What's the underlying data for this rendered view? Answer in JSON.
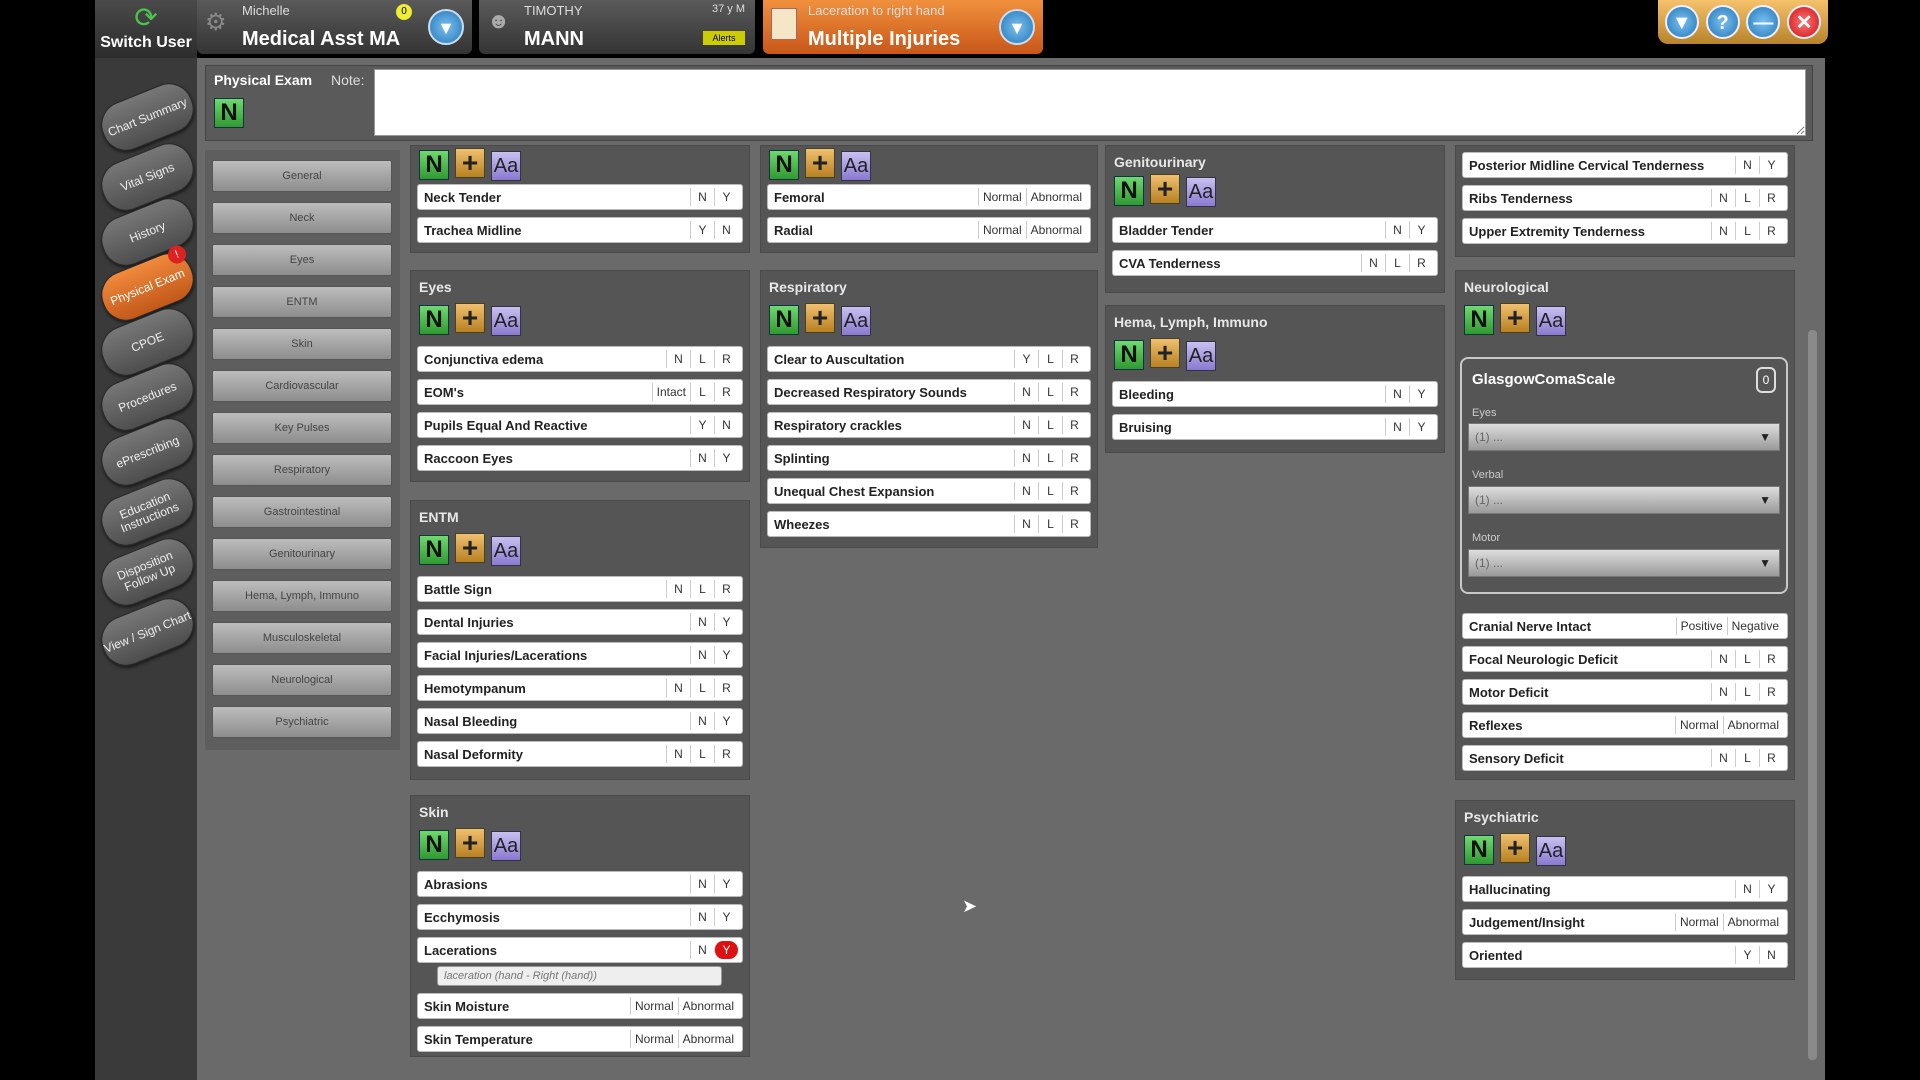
{
  "app": {
    "switch_user": "Switch User"
  },
  "side_tabs": [
    {
      "label": "Chart Summary"
    },
    {
      "label": "Vital Signs"
    },
    {
      "label": "History"
    },
    {
      "label": "Physical Exam",
      "active": true,
      "badge": "!"
    },
    {
      "label": "CPOE"
    },
    {
      "label": "Procedures"
    },
    {
      "label": "ePrescribing"
    },
    {
      "label": "Education Instructions"
    },
    {
      "label": "Disposition Follow Up"
    },
    {
      "label": "View / Sign Chart"
    }
  ],
  "header": {
    "user_name": "Michelle",
    "user_role": "Medical Asst MA",
    "user_badge": "0",
    "patient_first": "TIMOTHY",
    "patient_last": "MANN",
    "patient_age": "37 y M",
    "patient_tag": "Alerts",
    "complaint_small": "Laceration to right hand",
    "complaint_big": "Multiple Injuries"
  },
  "window_buttons": {
    "dropdown": "▼",
    "help": "?",
    "minimize": "—",
    "close": "✕"
  },
  "exam": {
    "title": "Physical Exam",
    "note_label": "Note:",
    "normal_btn": "N",
    "plus_btn": "+",
    "text_btn": "Aa"
  },
  "nav_buttons": [
    "General",
    "Neck",
    "Eyes",
    "ENTM",
    "Skin",
    "Cardiovascular",
    "Key Pulses",
    "Respiratory",
    "Gastrointestinal",
    "Genitourinary",
    "Hema, Lymph, Immuno",
    "Musculoskeletal",
    "Neurological",
    "Psychiatric"
  ],
  "panels": {
    "neck": {
      "rows": [
        {
          "label": "Neck Tender",
          "opts": [
            "N",
            "Y"
          ]
        },
        {
          "label": "Trachea Midline",
          "opts": [
            "Y",
            "N"
          ]
        }
      ]
    },
    "pulses": {
      "rows": [
        {
          "label": "Femoral",
          "opts": [
            "Normal",
            "Abnormal"
          ]
        },
        {
          "label": "Radial",
          "opts": [
            "Normal",
            "Abnormal"
          ]
        }
      ]
    },
    "genitourinary": {
      "title": "Genitourinary",
      "rows": [
        {
          "label": "Bladder Tender",
          "opts": [
            "N",
            "Y"
          ]
        },
        {
          "label": "CVA Tenderness",
          "opts": [
            "N",
            "L",
            "R"
          ]
        }
      ]
    },
    "musculo": {
      "rows": [
        {
          "label": "Posterior Midline Cervical Tenderness",
          "opts": [
            "N",
            "Y"
          ]
        },
        {
          "label": "Ribs Tenderness",
          "opts": [
            "N",
            "L",
            "R"
          ]
        },
        {
          "label": "Upper Extremity Tenderness",
          "opts": [
            "N",
            "L",
            "R"
          ]
        }
      ]
    },
    "eyes": {
      "title": "Eyes",
      "rows": [
        {
          "label": "Conjunctiva edema",
          "opts": [
            "N",
            "L",
            "R"
          ]
        },
        {
          "label": "EOM's",
          "opts": [
            "Intact",
            "L",
            "R"
          ]
        },
        {
          "label": "Pupils Equal And Reactive",
          "opts": [
            "Y",
            "N"
          ]
        },
        {
          "label": "Raccoon Eyes",
          "opts": [
            "N",
            "Y"
          ]
        }
      ]
    },
    "respiratory": {
      "title": "Respiratory",
      "rows": [
        {
          "label": "Clear to Auscultation",
          "opts": [
            "Y",
            "L",
            "R"
          ]
        },
        {
          "label": "Decreased Respiratory Sounds",
          "opts": [
            "N",
            "L",
            "R"
          ]
        },
        {
          "label": "Respiratory crackles",
          "opts": [
            "N",
            "L",
            "R"
          ]
        },
        {
          "label": "Splinting",
          "opts": [
            "N",
            "L",
            "R"
          ]
        },
        {
          "label": "Unequal Chest Expansion",
          "opts": [
            "N",
            "L",
            "R"
          ]
        },
        {
          "label": "Wheezes",
          "opts": [
            "N",
            "L",
            "R"
          ]
        }
      ]
    },
    "hema": {
      "title": "Hema, Lymph, Immuno",
      "rows": [
        {
          "label": "Bleeding",
          "opts": [
            "N",
            "Y"
          ]
        },
        {
          "label": "Bruising",
          "opts": [
            "N",
            "Y"
          ]
        }
      ]
    },
    "entm": {
      "title": "ENTM",
      "rows": [
        {
          "label": "Battle Sign",
          "opts": [
            "N",
            "L",
            "R"
          ]
        },
        {
          "label": "Dental Injuries",
          "opts": [
            "N",
            "Y"
          ]
        },
        {
          "label": "Facial Injuries/Lacerations",
          "opts": [
            "N",
            "Y"
          ]
        },
        {
          "label": "Hemotympanum",
          "opts": [
            "N",
            "L",
            "R"
          ]
        },
        {
          "label": "Nasal Bleeding",
          "opts": [
            "N",
            "Y"
          ]
        },
        {
          "label": "Nasal Deformity",
          "opts": [
            "N",
            "L",
            "R"
          ]
        }
      ]
    },
    "skin": {
      "title": "Skin",
      "rows": [
        {
          "label": "Abrasions",
          "opts": [
            "N",
            "Y"
          ]
        },
        {
          "label": "Ecchymosis",
          "opts": [
            "N",
            "Y"
          ]
        },
        {
          "label": "Lacerations",
          "opts": [
            "N",
            "Y"
          ],
          "selected": 1
        },
        {
          "label": "Skin Moisture",
          "opts": [
            "Normal",
            "Abnormal"
          ]
        },
        {
          "label": "Skin Temperature",
          "opts": [
            "Normal",
            "Abnormal"
          ]
        }
      ],
      "tooltip": "laceration (hand - Right (hand))"
    },
    "neurological": {
      "title": "Neurological",
      "gcs_title": "GlasgowComaScale",
      "gcs_score": "0",
      "gcs_fields": [
        {
          "label": "Eyes",
          "value": "(1) ..."
        },
        {
          "label": "Verbal",
          "value": "(1) ..."
        },
        {
          "label": "Motor",
          "value": "(1) ..."
        }
      ],
      "rows": [
        {
          "label": "Cranial Nerve Intact",
          "opts": [
            "Positive",
            "Negative"
          ]
        },
        {
          "label": "Focal Neurologic Deficit",
          "opts": [
            "N",
            "L",
            "R"
          ]
        },
        {
          "label": "Motor Deficit",
          "opts": [
            "N",
            "L",
            "R"
          ]
        },
        {
          "label": "Reflexes",
          "opts": [
            "Normal",
            "Abnormal"
          ]
        },
        {
          "label": "Sensory Deficit",
          "opts": [
            "N",
            "L",
            "R"
          ]
        }
      ]
    },
    "psychiatric": {
      "title": "Psychiatric",
      "rows": [
        {
          "label": "Hallucinating",
          "opts": [
            "N",
            "Y"
          ]
        },
        {
          "label": "Judgement/Insight",
          "opts": [
            "Normal",
            "Abnormal"
          ]
        },
        {
          "label": "Oriented",
          "opts": [
            "Y",
            "N"
          ]
        }
      ]
    }
  },
  "colors": {
    "accent_orange": "#e07a2e",
    "normal_green": "#3fae3f",
    "selected_red": "#d11111"
  }
}
